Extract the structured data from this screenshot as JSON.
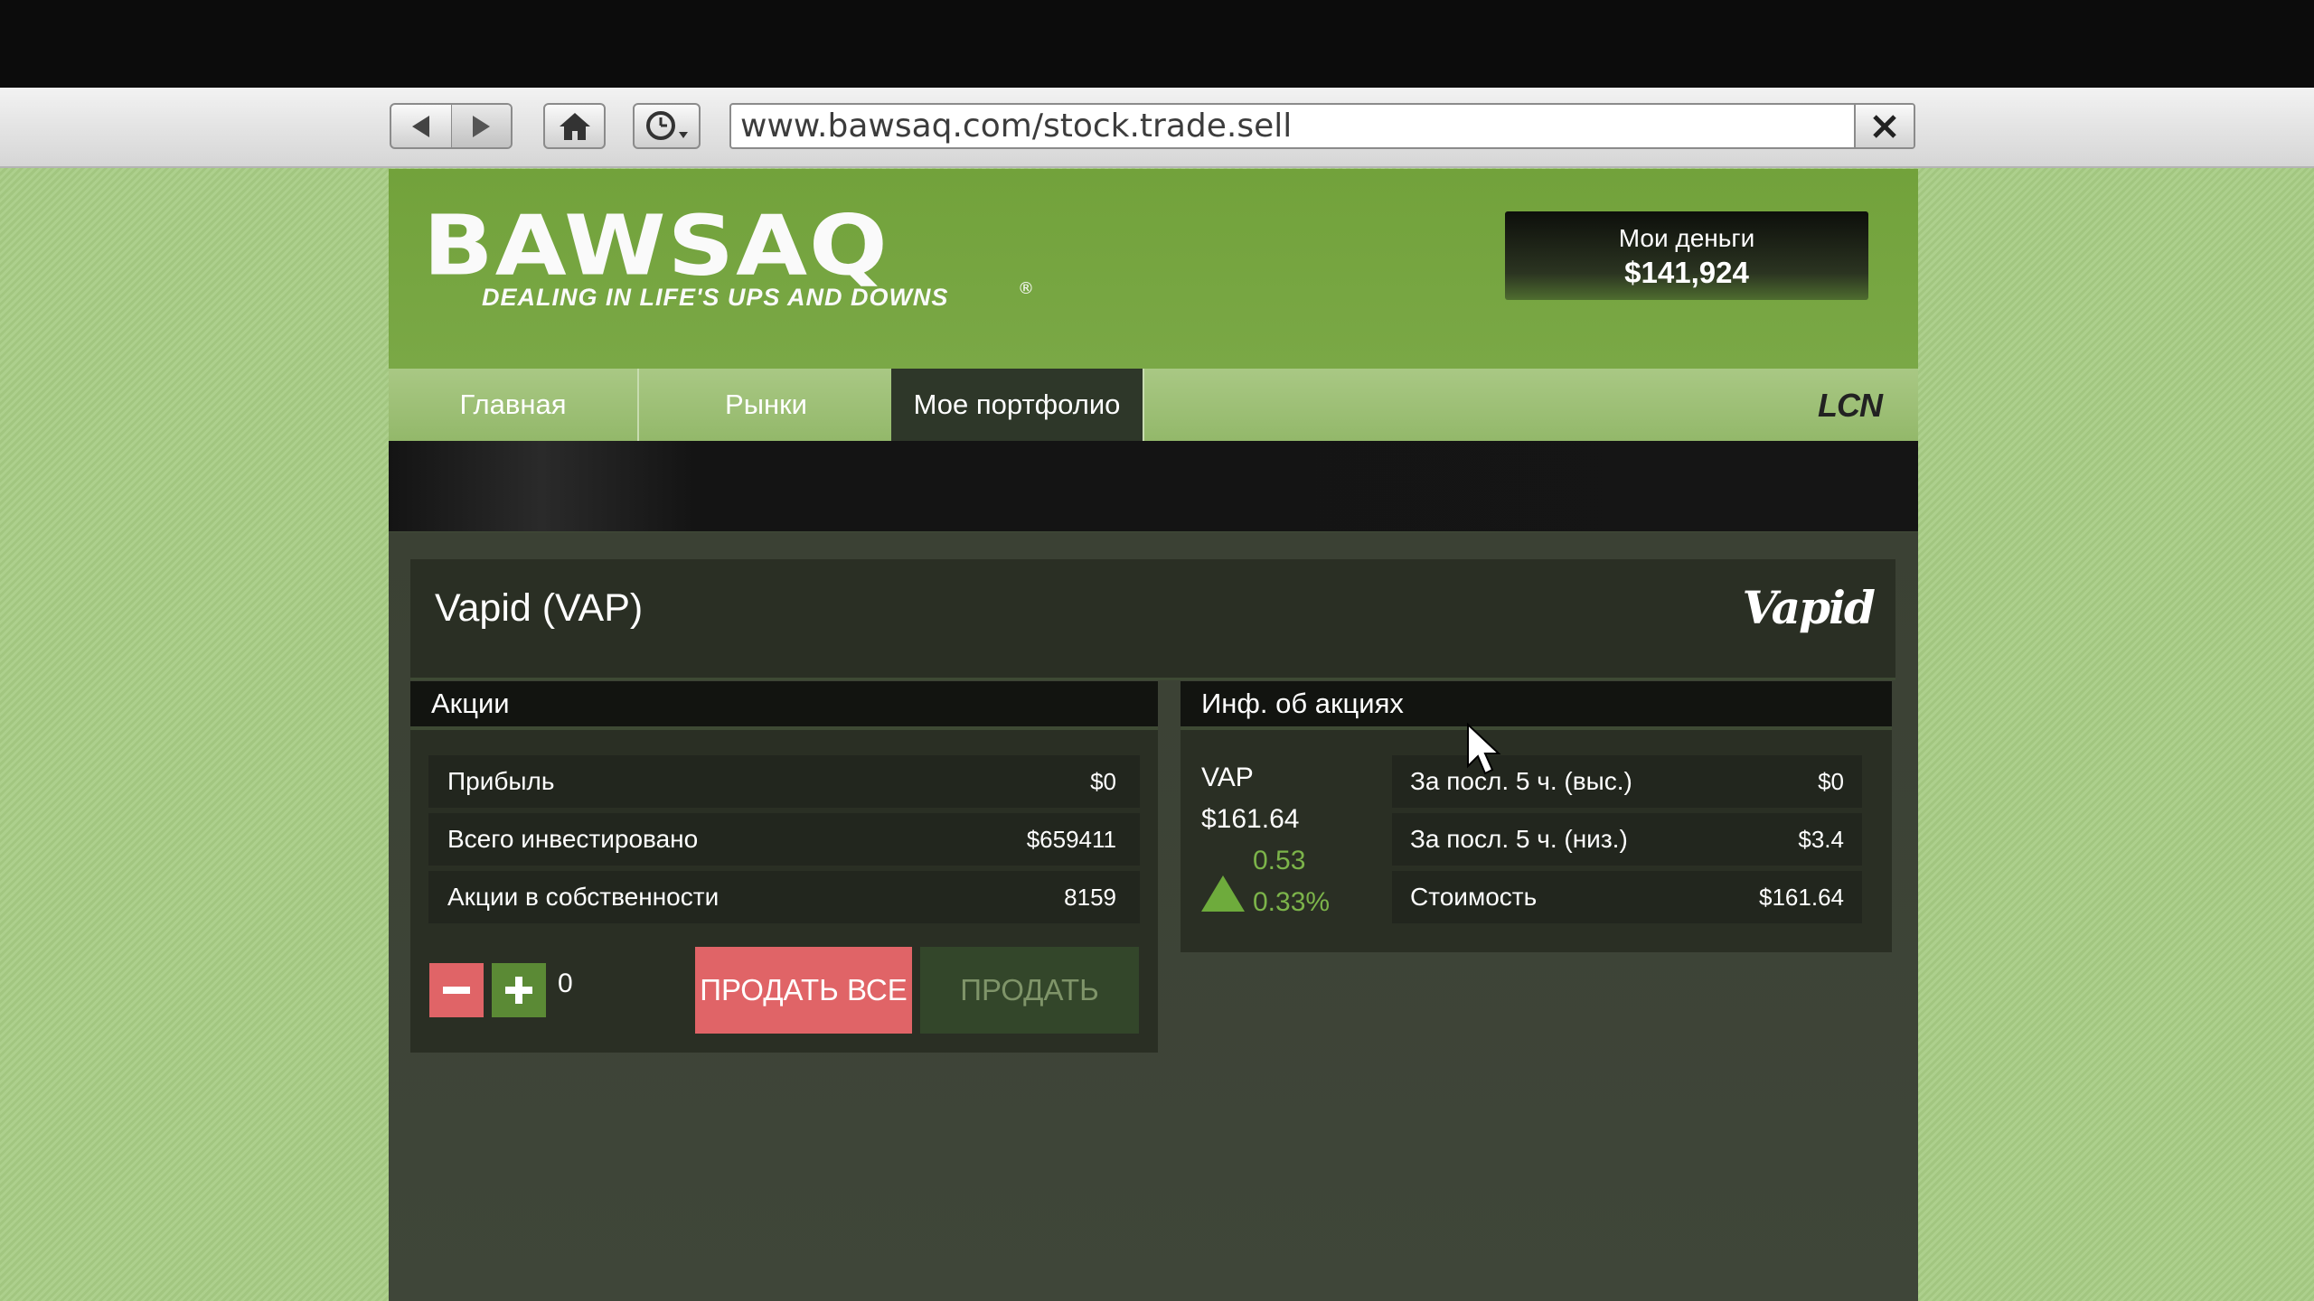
{
  "browser": {
    "url": "www.bawsaq.com/stock.trade.sell",
    "icons": [
      "back-icon",
      "forward-icon",
      "home-icon",
      "history-icon",
      "close-icon"
    ]
  },
  "site": {
    "logo_text": "BAWSAQ",
    "tagline": "DEALING IN LIFE'S UPS AND DOWNS",
    "money": {
      "label": "Мои деньги",
      "value": "$141,924"
    },
    "nav": [
      {
        "label": "Главная"
      },
      {
        "label": "Рынки"
      },
      {
        "label": "Мое портфолио",
        "active": true
      }
    ],
    "partner_logo": "LCN"
  },
  "stock": {
    "title": "Vapid (VAP)",
    "brand_logo": "Vapid",
    "shares_panel": {
      "heading": "Акции",
      "rows": [
        {
          "label": "Прибыль",
          "value": "$0"
        },
        {
          "label": "Всего инвестировано",
          "value": "$659411"
        },
        {
          "label": "Акции в собственности",
          "value": "8159"
        }
      ],
      "quantity": "0",
      "sell_all_label": "ПРОДАТЬ ВСЕ",
      "sell_label": "ПРОДАТЬ"
    },
    "info_panel": {
      "heading": "Инф. об акциях",
      "symbol": "VAP",
      "price": "$161.64",
      "change": "0.53",
      "change_pct": "0.33%",
      "trend": "up",
      "rows": [
        {
          "label": "За посл. 5 ч. (выс.)",
          "value": "$0"
        },
        {
          "label": "За посл. 5 ч. (низ.)",
          "value": "$3.4"
        },
        {
          "label": "Стоимость",
          "value": "$161.64"
        }
      ]
    }
  },
  "colors": {
    "brand_green": "#77a543",
    "sell_all_red": "#e06467",
    "sell_disabled": "#33462a",
    "up_green": "#7cb44a"
  }
}
